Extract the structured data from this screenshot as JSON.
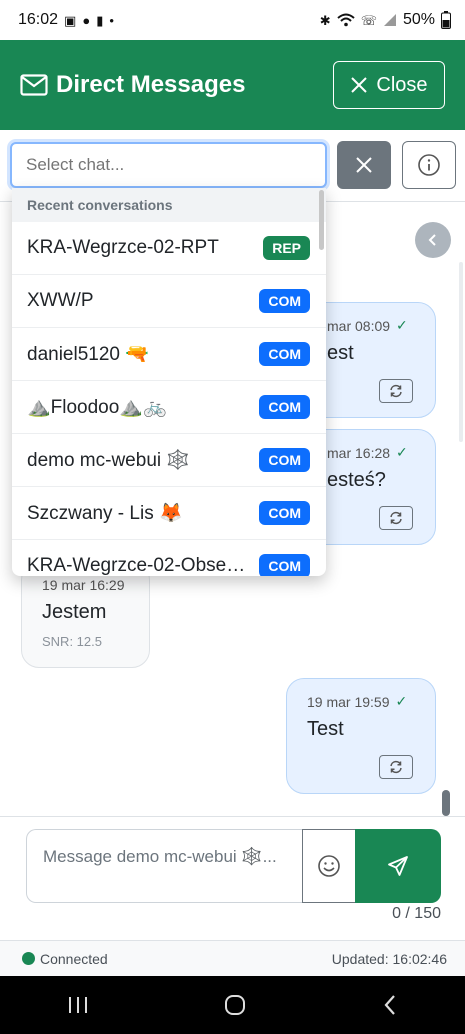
{
  "status_bar": {
    "time": "16:02",
    "battery": "50%"
  },
  "header": {
    "title": "Direct Messages",
    "close_label": "Close"
  },
  "toolbar": {
    "select_placeholder": "Select chat..."
  },
  "dropdown": {
    "section_label": "Recent conversations",
    "items": [
      {
        "name": "KRA-Wegrzce-02-RPT",
        "badge": "REP"
      },
      {
        "name": "XWW/P",
        "badge": "COM"
      },
      {
        "name": "daniel5120 🔫",
        "badge": "COM"
      },
      {
        "name": "⛰️Floodoo⛰️🚲",
        "badge": "COM"
      },
      {
        "name": "demo mc-webui 🕸️",
        "badge": "COM"
      },
      {
        "name": "Szczwany - Lis 🦊",
        "badge": "COM"
      },
      {
        "name": "KRA-Wegrzce-02-Obse…",
        "badge": "COM"
      }
    ]
  },
  "messages": [
    {
      "meta": "mar 08:09",
      "text": "est",
      "direction": "out"
    },
    {
      "meta": "mar 16:28",
      "text": "esteś?",
      "direction": "out"
    },
    {
      "meta": "19 mar 16:29",
      "text": "Jestem",
      "snr": "SNR: 12.5",
      "direction": "in"
    },
    {
      "meta": "19 mar 19:59",
      "text": "Test",
      "direction": "out"
    }
  ],
  "composer": {
    "placeholder": "Message demo mc-webui 🕸️...",
    "counter": "0 / 150"
  },
  "footer": {
    "connection": "Connected",
    "updated": "Updated: 16:02:46"
  },
  "colors": {
    "primary_green": "#198754",
    "com_blue": "#0d6efd",
    "bubble_out": "#e7f1ff"
  }
}
